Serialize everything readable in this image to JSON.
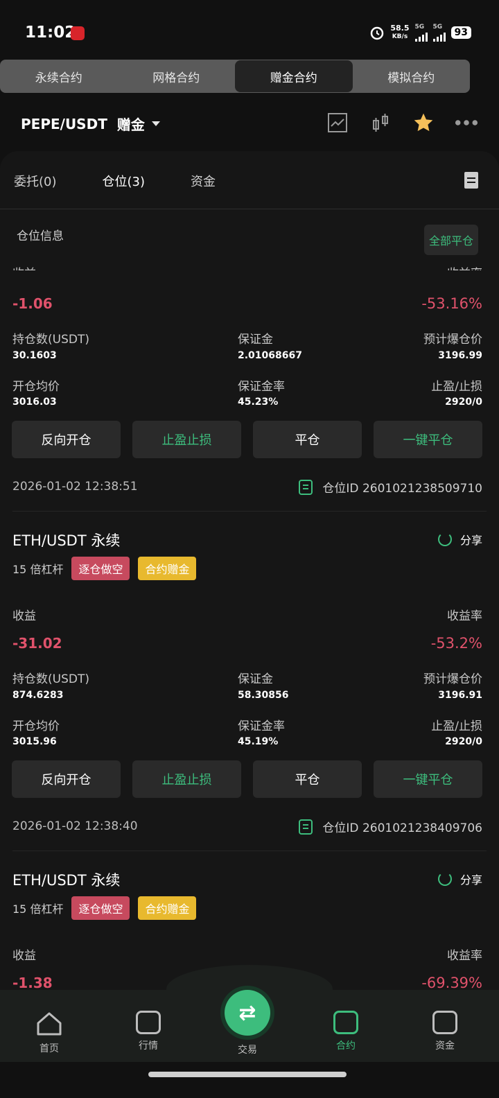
{
  "status": {
    "time": "11:02",
    "net_speed": "58.5",
    "net_unit": "KB/s",
    "sig1": "5G",
    "sig2": "5G",
    "battery": "93"
  },
  "top_tabs": [
    "永续合约",
    "网格合约",
    "赠金合约",
    "模拟合约"
  ],
  "header": {
    "pair": "PEPE/USDT",
    "mode": "赠金"
  },
  "sub_tabs": [
    "委托(0)",
    "仓位(3)",
    "资金"
  ],
  "positions_title": "仓位信息",
  "close_all": "全部平仓",
  "labels": {
    "pnl": "收益",
    "pnl_rate": "收益率",
    "holding": "持仓数(USDT)",
    "margin": "保证金",
    "liq": "预计爆仓价",
    "entry": "开仓均价",
    "margin_rate": "保证金率",
    "tpsl": "止盈/止损",
    "pos_id": "仓位ID",
    "share": "分享"
  },
  "buttons": [
    "反向开仓",
    "止盈止损",
    "平仓",
    "一键平仓"
  ],
  "positions": [
    {
      "pnl": "-1.06",
      "pnl_rate": "-53.16%",
      "holding": "30.1603",
      "margin": "2.01068667",
      "liq": "3196.99",
      "entry": "3016.03",
      "margin_rate": "45.23%",
      "tpsl": "2920/0",
      "time": "2026-01-02 12:38:51",
      "id": "2601021238509710"
    },
    {
      "symbol": "ETH/USDT 永续",
      "leverage": "15 倍杠杆",
      "tag1": "逐仓做空",
      "tag2": "合约赠金",
      "pnl": "-31.02",
      "pnl_rate": "-53.2%",
      "holding": "874.6283",
      "margin": "58.30856",
      "liq": "3196.91",
      "entry": "3015.96",
      "margin_rate": "45.19%",
      "tpsl": "2920/0",
      "time": "2026-01-02 12:38:40",
      "id": "2601021238409706"
    },
    {
      "symbol": "ETH/USDT 永续",
      "leverage": "15 倍杠杆",
      "tag1": "逐仓做空",
      "tag2": "合约赠金",
      "pnl": "-1.38",
      "pnl_rate": "-69.39%"
    }
  ],
  "nav": [
    "首页",
    "行情",
    "交易",
    "合约",
    "资金"
  ],
  "colors": {
    "accent": "#3dbd7d",
    "loss": "#e0526b",
    "tag_short": "#c74a5e",
    "tag_bonus": "#e8b92e"
  }
}
